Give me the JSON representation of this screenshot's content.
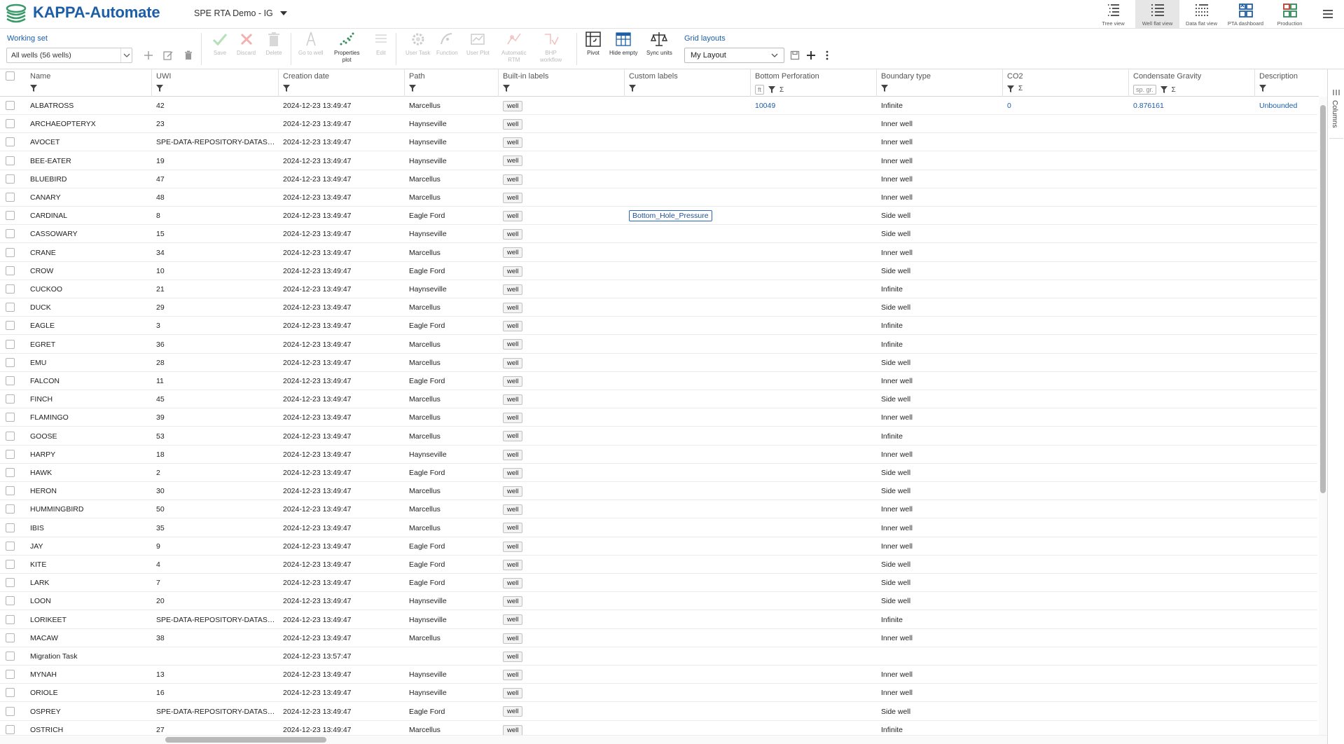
{
  "app": {
    "title": "KAPPA-Automate",
    "project": "SPE RTA Demo - IG"
  },
  "views": [
    {
      "label": "Tree view",
      "icon": "tree-view-icon"
    },
    {
      "label": "Well flat view",
      "icon": "well-flat-view-icon"
    },
    {
      "label": "Data flat view",
      "icon": "data-flat-view-icon"
    },
    {
      "label": "PTA dashboard",
      "icon": "pta-dashboard-icon"
    },
    {
      "label": "Production",
      "icon": "production-icon"
    }
  ],
  "toolbar": {
    "working_set_title": "Working set",
    "working_set_value": "All wells (56 wells)",
    "save": "Save",
    "discard": "Discard",
    "delete": "Delete",
    "go_to_well": "Go to well",
    "properties_plot_1": "Properties",
    "properties_plot_2": "plot",
    "edit": "Edit",
    "user_task": "User Task",
    "function": "Function",
    "user_plot": "User Plot",
    "auto_rtm_1": "Automatic",
    "auto_rtm_2": "RTM",
    "bhp_1": "BHP",
    "bhp_2": "workflow",
    "pivot": "Pivot",
    "hide_empty": "Hide empty",
    "sync_units": "Sync units",
    "grid_layouts_title": "Grid layouts",
    "grid_layout_value": "My Layout"
  },
  "columns": {
    "name": "Name",
    "uwi": "UWI",
    "creation_date": "Creation date",
    "path": "Path",
    "builtin_labels": "Built-in labels",
    "custom_labels": "Custom labels",
    "bottom_perforation": "Bottom Perforation",
    "bottom_perforation_unit": "ft",
    "boundary_type": "Boundary type",
    "co2": "CO2",
    "condensate_gravity": "Condensate Gravity",
    "condensate_gravity_unit": "sp. gr.",
    "description": "Description"
  },
  "side_panel": {
    "columns_tab": "Columns"
  },
  "rows": [
    {
      "name": "ALBATROSS",
      "uwi": "42",
      "date": "2024-12-23 13:49:47",
      "path": "Marcellus",
      "label": "well",
      "custom": "",
      "bottom_perf": "10049",
      "boundary": "Infinite",
      "co2": "0",
      "cond": "0.876161",
      "desc": "Unbounded"
    },
    {
      "name": "ARCHAEOPTERYX",
      "uwi": "23",
      "date": "2024-12-23 13:49:47",
      "path": "Haynseville",
      "label": "well",
      "custom": "",
      "bottom_perf": "",
      "boundary": "Inner well",
      "co2": "",
      "cond": "",
      "desc": ""
    },
    {
      "name": "AVOCET",
      "uwi": "SPE-DATA-REPOSITORY-DATASET-",
      "date": "2024-12-23 13:49:47",
      "path": "Haynseville",
      "label": "well",
      "custom": "",
      "bottom_perf": "",
      "boundary": "Inner well",
      "co2": "",
      "cond": "",
      "desc": ""
    },
    {
      "name": "BEE-EATER",
      "uwi": "19",
      "date": "2024-12-23 13:49:47",
      "path": "Haynseville",
      "label": "well",
      "custom": "",
      "bottom_perf": "",
      "boundary": "Inner well",
      "co2": "",
      "cond": "",
      "desc": ""
    },
    {
      "name": "BLUEBIRD",
      "uwi": "47",
      "date": "2024-12-23 13:49:47",
      "path": "Marcellus",
      "label": "well",
      "custom": "",
      "bottom_perf": "",
      "boundary": "Inner well",
      "co2": "",
      "cond": "",
      "desc": ""
    },
    {
      "name": "CANARY",
      "uwi": "48",
      "date": "2024-12-23 13:49:47",
      "path": "Marcellus",
      "label": "well",
      "custom": "",
      "bottom_perf": "",
      "boundary": "Inner well",
      "co2": "",
      "cond": "",
      "desc": ""
    },
    {
      "name": "CARDINAL",
      "uwi": "8",
      "date": "2024-12-23 13:49:47",
      "path": "Eagle Ford",
      "label": "well",
      "custom": "Bottom_Hole_Pressure",
      "bottom_perf": "",
      "boundary": "Side well",
      "co2": "",
      "cond": "",
      "desc": ""
    },
    {
      "name": "CASSOWARY",
      "uwi": "15",
      "date": "2024-12-23 13:49:47",
      "path": "Haynseville",
      "label": "well",
      "custom": "",
      "bottom_perf": "",
      "boundary": "Side well",
      "co2": "",
      "cond": "",
      "desc": ""
    },
    {
      "name": "CRANE",
      "uwi": "34",
      "date": "2024-12-23 13:49:47",
      "path": "Marcellus",
      "label": "well",
      "custom": "",
      "bottom_perf": "",
      "boundary": "Inner well",
      "co2": "",
      "cond": "",
      "desc": ""
    },
    {
      "name": "CROW",
      "uwi": "10",
      "date": "2024-12-23 13:49:47",
      "path": "Eagle Ford",
      "label": "well",
      "custom": "",
      "bottom_perf": "",
      "boundary": "Side well",
      "co2": "",
      "cond": "",
      "desc": ""
    },
    {
      "name": "CUCKOO",
      "uwi": "21",
      "date": "2024-12-23 13:49:47",
      "path": "Haynseville",
      "label": "well",
      "custom": "",
      "bottom_perf": "",
      "boundary": "Infinite",
      "co2": "",
      "cond": "",
      "desc": ""
    },
    {
      "name": "DUCK",
      "uwi": "29",
      "date": "2024-12-23 13:49:47",
      "path": "Marcellus",
      "label": "well",
      "custom": "",
      "bottom_perf": "",
      "boundary": "Side well",
      "co2": "",
      "cond": "",
      "desc": ""
    },
    {
      "name": "EAGLE",
      "uwi": "3",
      "date": "2024-12-23 13:49:47",
      "path": "Eagle Ford",
      "label": "well",
      "custom": "",
      "bottom_perf": "",
      "boundary": "Infinite",
      "co2": "",
      "cond": "",
      "desc": ""
    },
    {
      "name": "EGRET",
      "uwi": "36",
      "date": "2024-12-23 13:49:47",
      "path": "Marcellus",
      "label": "well",
      "custom": "",
      "bottom_perf": "",
      "boundary": "Infinite",
      "co2": "",
      "cond": "",
      "desc": ""
    },
    {
      "name": "EMU",
      "uwi": "28",
      "date": "2024-12-23 13:49:47",
      "path": "Marcellus",
      "label": "well",
      "custom": "",
      "bottom_perf": "",
      "boundary": "Side well",
      "co2": "",
      "cond": "",
      "desc": ""
    },
    {
      "name": "FALCON",
      "uwi": "11",
      "date": "2024-12-23 13:49:47",
      "path": "Eagle Ford",
      "label": "well",
      "custom": "",
      "bottom_perf": "",
      "boundary": "Inner well",
      "co2": "",
      "cond": "",
      "desc": ""
    },
    {
      "name": "FINCH",
      "uwi": "45",
      "date": "2024-12-23 13:49:47",
      "path": "Marcellus",
      "label": "well",
      "custom": "",
      "bottom_perf": "",
      "boundary": "Side well",
      "co2": "",
      "cond": "",
      "desc": ""
    },
    {
      "name": "FLAMINGO",
      "uwi": "39",
      "date": "2024-12-23 13:49:47",
      "path": "Marcellus",
      "label": "well",
      "custom": "",
      "bottom_perf": "",
      "boundary": "Inner well",
      "co2": "",
      "cond": "",
      "desc": ""
    },
    {
      "name": "GOOSE",
      "uwi": "53",
      "date": "2024-12-23 13:49:47",
      "path": "Marcellus",
      "label": "well",
      "custom": "",
      "bottom_perf": "",
      "boundary": "Infinite",
      "co2": "",
      "cond": "",
      "desc": ""
    },
    {
      "name": "HARPY",
      "uwi": "18",
      "date": "2024-12-23 13:49:47",
      "path": "Haynseville",
      "label": "well",
      "custom": "",
      "bottom_perf": "",
      "boundary": "Inner well",
      "co2": "",
      "cond": "",
      "desc": ""
    },
    {
      "name": "HAWK",
      "uwi": "2",
      "date": "2024-12-23 13:49:47",
      "path": "Eagle Ford",
      "label": "well",
      "custom": "",
      "bottom_perf": "",
      "boundary": "Side well",
      "co2": "",
      "cond": "",
      "desc": ""
    },
    {
      "name": "HERON",
      "uwi": "30",
      "date": "2024-12-23 13:49:47",
      "path": "Marcellus",
      "label": "well",
      "custom": "",
      "bottom_perf": "",
      "boundary": "Side well",
      "co2": "",
      "cond": "",
      "desc": ""
    },
    {
      "name": "HUMMINGBIRD",
      "uwi": "50",
      "date": "2024-12-23 13:49:47",
      "path": "Marcellus",
      "label": "well",
      "custom": "",
      "bottom_perf": "",
      "boundary": "Inner well",
      "co2": "",
      "cond": "",
      "desc": ""
    },
    {
      "name": "IBIS",
      "uwi": "35",
      "date": "2024-12-23 13:49:47",
      "path": "Marcellus",
      "label": "well",
      "custom": "",
      "bottom_perf": "",
      "boundary": "Inner well",
      "co2": "",
      "cond": "",
      "desc": ""
    },
    {
      "name": "JAY",
      "uwi": "9",
      "date": "2024-12-23 13:49:47",
      "path": "Eagle Ford",
      "label": "well",
      "custom": "",
      "bottom_perf": "",
      "boundary": "Inner well",
      "co2": "",
      "cond": "",
      "desc": ""
    },
    {
      "name": "KITE",
      "uwi": "4",
      "date": "2024-12-23 13:49:47",
      "path": "Eagle Ford",
      "label": "well",
      "custom": "",
      "bottom_perf": "",
      "boundary": "Side well",
      "co2": "",
      "cond": "",
      "desc": ""
    },
    {
      "name": "LARK",
      "uwi": "7",
      "date": "2024-12-23 13:49:47",
      "path": "Eagle Ford",
      "label": "well",
      "custom": "",
      "bottom_perf": "",
      "boundary": "Side well",
      "co2": "",
      "cond": "",
      "desc": ""
    },
    {
      "name": "LOON",
      "uwi": "20",
      "date": "2024-12-23 13:49:47",
      "path": "Haynseville",
      "label": "well",
      "custom": "",
      "bottom_perf": "",
      "boundary": "Side well",
      "co2": "",
      "cond": "",
      "desc": ""
    },
    {
      "name": "LORIKEET",
      "uwi": "SPE-DATA-REPOSITORY-DATASET-",
      "date": "2024-12-23 13:49:47",
      "path": "Haynseville",
      "label": "well",
      "custom": "",
      "bottom_perf": "",
      "boundary": "Infinite",
      "co2": "",
      "cond": "",
      "desc": ""
    },
    {
      "name": "MACAW",
      "uwi": "38",
      "date": "2024-12-23 13:49:47",
      "path": "Marcellus",
      "label": "well",
      "custom": "",
      "bottom_perf": "",
      "boundary": "Inner well",
      "co2": "",
      "cond": "",
      "desc": ""
    },
    {
      "name": "Migration Task",
      "uwi": "",
      "date": "2024-12-23 13:57:47",
      "path": "",
      "label": "well",
      "custom": "",
      "bottom_perf": "",
      "boundary": "",
      "co2": "",
      "cond": "",
      "desc": ""
    },
    {
      "name": "MYNAH",
      "uwi": "13",
      "date": "2024-12-23 13:49:47",
      "path": "Haynseville",
      "label": "well",
      "custom": "",
      "bottom_perf": "",
      "boundary": "Inner well",
      "co2": "",
      "cond": "",
      "desc": ""
    },
    {
      "name": "ORIOLE",
      "uwi": "16",
      "date": "2024-12-23 13:49:47",
      "path": "Haynseville",
      "label": "well",
      "custom": "",
      "bottom_perf": "",
      "boundary": "Inner well",
      "co2": "",
      "cond": "",
      "desc": ""
    },
    {
      "name": "OSPREY",
      "uwi": "SPE-DATA-REPOSITORY-DATASET-",
      "date": "2024-12-23 13:49:47",
      "path": "Eagle Ford",
      "label": "well",
      "custom": "",
      "bottom_perf": "",
      "boundary": "Side well",
      "co2": "",
      "cond": "",
      "desc": ""
    },
    {
      "name": "OSTRICH",
      "uwi": "27",
      "date": "2024-12-23 13:49:47",
      "path": "Marcellus",
      "label": "well",
      "custom": "",
      "bottom_perf": "",
      "boundary": "Infinite",
      "co2": "",
      "cond": "",
      "desc": ""
    }
  ]
}
